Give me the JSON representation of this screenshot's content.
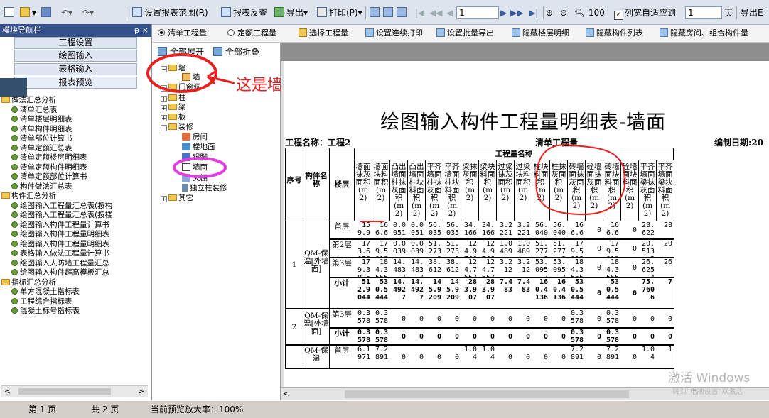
{
  "toolbar1": {
    "set_range": "设置报表范围(R)",
    "review": "报表反查",
    "export": "导出",
    "print": "打印(P)",
    "page_value": "1",
    "zoom_value": "100",
    "fit_width": "列宽自适应到",
    "fit_value": "1",
    "page_unit": "页",
    "export_xls": "导出E"
  },
  "left_nav": {
    "header": "模块导航栏",
    "pin": "ᵽ ×",
    "buttons": [
      "工程设置",
      "绘图输入",
      "表格输入",
      "报表预览"
    ],
    "tree": [
      {
        "type": "folder",
        "label": "做法汇总分析"
      },
      {
        "type": "leaf",
        "label": "清单汇总表"
      },
      {
        "type": "leaf",
        "label": "清单楼层明细表"
      },
      {
        "type": "leaf",
        "label": "清单构件明细表"
      },
      {
        "type": "leaf",
        "label": "清单部位计算书"
      },
      {
        "type": "leaf",
        "label": "清单定额汇总表"
      },
      {
        "type": "leaf",
        "label": "清单定额楼层明细表"
      },
      {
        "type": "leaf",
        "label": "清单定额构件明细表"
      },
      {
        "type": "leaf",
        "label": "清单定额部位计算书"
      },
      {
        "type": "leaf",
        "label": "构件做法汇总表"
      },
      {
        "type": "folder",
        "label": "构件汇总分析"
      },
      {
        "type": "leaf",
        "label": "绘图输入工程量汇总表(按构"
      },
      {
        "type": "leaf",
        "label": "绘图输入工程量汇总表(按楼"
      },
      {
        "type": "leaf",
        "label": "绘图输入构件工程量计算书"
      },
      {
        "type": "leaf",
        "label": "绘图输入构件工程量明细表"
      },
      {
        "type": "leaf",
        "label": "绘图输入构件工程量明细表"
      },
      {
        "type": "leaf",
        "label": "表格输入做法工程量计算书"
      },
      {
        "type": "leaf",
        "label": "绘图输入人防墙工程量汇总"
      },
      {
        "type": "leaf",
        "label": "绘图输入构件超高模板汇总"
      },
      {
        "type": "folder",
        "label": "指标汇总分析"
      },
      {
        "type": "leaf",
        "label": "单方混凝土指标表"
      },
      {
        "type": "leaf",
        "label": "工程综合指标表"
      },
      {
        "type": "leaf",
        "label": "混凝土标号指标表"
      }
    ]
  },
  "toolbar2": {
    "radio1": "清单工程量",
    "radio2": "定额工程量",
    "choose": "选择工程量",
    "continuous_print": "设置连续打印",
    "batch_export": "设置批量导出",
    "hide_floor": "隐藏楼层明细",
    "hide_list": "隐藏构件列表",
    "hide_room": "隐藏房间、组合构件量"
  },
  "comp_tree": {
    "expand_all": "全部展开",
    "collapse_all": "全部折叠",
    "items": [
      "墙",
      "墙",
      "门窗洞",
      "柱",
      "梁",
      "板",
      "装修",
      "房间",
      "楼地面",
      "踢脚",
      "墙面",
      "天棚",
      "独立柱装修",
      "其它"
    ]
  },
  "annotation": "这是墙体",
  "report": {
    "title": "绘图输入构件工程量明细表-墙面",
    "project_label": "工程名称：工程2",
    "type_label": "清单工程量",
    "date_label": "编制日期:20",
    "group_header": "工程量名称",
    "col_headers": [
      "序号",
      "构件名称",
      "楼层"
    ],
    "qty_headers": [
      "墙面抹灰面积(m2)",
      "墙面块料面积(m2)",
      "凸出墙面柱抹灰面积(m2)",
      "凸出墙面柱块料面积(m2)",
      "平齐墙面柱抹灰面积(m2)",
      "平齐墙面柱块料面积(m2)",
      "梁抹灰面积(m2)",
      "梁块料面积(m2)",
      "过梁抹灰面积(m2)",
      "过梁块料面积(m2)",
      "柱块料面积(m2)",
      "柱抹灰面积(m2)",
      "砖墙面抹灰面积(m2)",
      "砼墙面抹灰面积(m2)",
      "砖墙面块料面积(m2)",
      "砼墙面块料面积(m2)",
      "平齐墙面梁抹灰面积(m2)",
      "平齐墙面梁块料面积(m2)"
    ],
    "groups": [
      {
        "seq": "1",
        "name": "QM-保温[外墙面]",
        "rows": [
          {
            "floor": "首层",
            "values": [
              "159.9941",
              "166.6861",
              "0.0051",
              "0.0051",
              "56.035",
              "56.035",
              "34.1667",
              "34.1667",
              "3.2221",
              "3.2221",
              "56.0401",
              "56.0401",
              "166.6861",
              "0",
              "166.6861",
              "0",
              "28.622",
              "28"
            ]
          },
          {
            "floor": "第2层",
            "values": [
              "173.6078",
              "179.5018",
              "0.0039",
              "0.0039",
              "51.2739",
              "51.2739",
              "124.9746",
              "124.9746",
              "1.0489",
              "1.0489",
              "51.2778",
              "51.2778",
              "179.5018",
              "0",
              "179.5018",
              "0",
              "20.5132",
              "20"
            ]
          },
          {
            "floor": "第3层",
            "values": [
              "179.3025",
              "184.3565",
              "14.4837",
              "14.4837",
              "38.612",
              "38.612",
              "124.7657",
              "124.7657",
              "3.212",
              "3.212",
              "53.0957",
              "53.0957",
              "184.3565",
              "0",
              "184.3565",
              "0",
              "26.6254",
              "26"
            ]
          },
          {
            "floor": "小计",
            "values": [
              "512.9044",
              "530.5444",
              "14.4927",
              "14.4927",
              "145.9209",
              "145.9209",
              "283.907",
              "283.907",
              "7.483",
              "7.483",
              "160.4136",
              "160.4136",
              "530.5444",
              "0",
              "530.5444",
              "0",
              "75.7606",
              "7"
            ]
          }
        ]
      },
      {
        "seq": "2",
        "name": "QM-保温[外墙面]",
        "rows": [
          {
            "floor": "第3层",
            "values": [
              "0.3578",
              "0.3578",
              "0",
              "0",
              "0",
              "0",
              "0",
              "0",
              "0",
              "0",
              "0",
              "0",
              "0.3578",
              "0",
              "0.3578",
              "0",
              "0",
              "0"
            ]
          },
          {
            "floor": "小计",
            "values": [
              "0.3578",
              "0.3578",
              "0",
              "0",
              "0",
              "0",
              "0",
              "0",
              "0",
              "0",
              "0",
              "0",
              "0.3578",
              "0",
              "0.3578",
              "0",
              "0",
              "0"
            ]
          }
        ]
      },
      {
        "seq": "",
        "name": "QM-保温",
        "rows": [
          {
            "floor": "首层",
            "values": [
              "6.1971",
              "7.2891",
              "0",
              "0",
              "0",
              "0",
              "1.04",
              "1.04",
              "0",
              "0",
              "0",
              "0",
              "7.2891",
              "0",
              "7.2891",
              "0",
              "1.04",
              "1"
            ]
          }
        ]
      }
    ]
  },
  "watermark": {
    "line1": "激活 Windows",
    "line2": "转到\"电脑设置\"以激活"
  },
  "status": {
    "page": "第 1 页",
    "total": "共 2 页",
    "zoom": "当前预览放大率：100%"
  }
}
